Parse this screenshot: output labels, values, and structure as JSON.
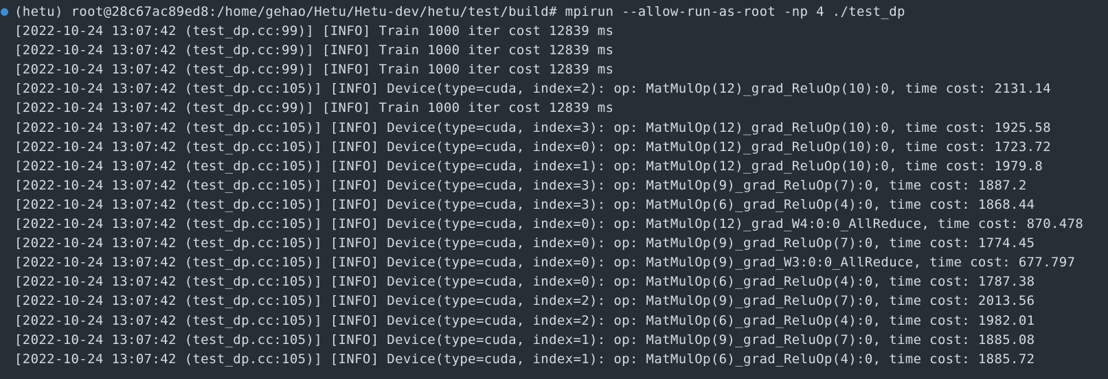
{
  "terminal": {
    "prompt": "(hetu) root@28c67ac89ed8:/home/gehao/Hetu/Hetu-dev/hetu/test/build# mpirun --allow-run-as-root -np 4 ./test_dp",
    "colors": {
      "background": "#262f36",
      "text": "#d6dbe0",
      "status_dot": "#3a8fd6"
    },
    "lines": [
      "[2022-10-24 13:07:42 (test_dp.cc:99)] [INFO] Train 1000 iter cost 12839 ms",
      "[2022-10-24 13:07:42 (test_dp.cc:99)] [INFO] Train 1000 iter cost 12839 ms",
      "[2022-10-24 13:07:42 (test_dp.cc:99)] [INFO] Train 1000 iter cost 12839 ms",
      "[2022-10-24 13:07:42 (test_dp.cc:105)] [INFO] Device(type=cuda, index=2): op: MatMulOp(12)_grad_ReluOp(10):0, time cost: 2131.14",
      "[2022-10-24 13:07:42 (test_dp.cc:99)] [INFO] Train 1000 iter cost 12839 ms",
      "[2022-10-24 13:07:42 (test_dp.cc:105)] [INFO] Device(type=cuda, index=3): op: MatMulOp(12)_grad_ReluOp(10):0, time cost: 1925.58",
      "[2022-10-24 13:07:42 (test_dp.cc:105)] [INFO] Device(type=cuda, index=0): op: MatMulOp(12)_grad_ReluOp(10):0, time cost: 1723.72",
      "[2022-10-24 13:07:42 (test_dp.cc:105)] [INFO] Device(type=cuda, index=1): op: MatMulOp(12)_grad_ReluOp(10):0, time cost: 1979.8",
      "[2022-10-24 13:07:42 (test_dp.cc:105)] [INFO] Device(type=cuda, index=3): op: MatMulOp(9)_grad_ReluOp(7):0, time cost: 1887.2",
      "[2022-10-24 13:07:42 (test_dp.cc:105)] [INFO] Device(type=cuda, index=3): op: MatMulOp(6)_grad_ReluOp(4):0, time cost: 1868.44",
      "[2022-10-24 13:07:42 (test_dp.cc:105)] [INFO] Device(type=cuda, index=0): op: MatMulOp(12)_grad_W4:0:0_AllReduce, time cost: 870.478",
      "[2022-10-24 13:07:42 (test_dp.cc:105)] [INFO] Device(type=cuda, index=0): op: MatMulOp(9)_grad_ReluOp(7):0, time cost: 1774.45",
      "[2022-10-24 13:07:42 (test_dp.cc:105)] [INFO] Device(type=cuda, index=0): op: MatMulOp(9)_grad_W3:0:0_AllReduce, time cost: 677.797",
      "[2022-10-24 13:07:42 (test_dp.cc:105)] [INFO] Device(type=cuda, index=0): op: MatMulOp(6)_grad_ReluOp(4):0, time cost: 1787.38",
      "[2022-10-24 13:07:42 (test_dp.cc:105)] [INFO] Device(type=cuda, index=2): op: MatMulOp(9)_grad_ReluOp(7):0, time cost: 2013.56",
      "[2022-10-24 13:07:42 (test_dp.cc:105)] [INFO] Device(type=cuda, index=2): op: MatMulOp(6)_grad_ReluOp(4):0, time cost: 1982.01",
      "[2022-10-24 13:07:42 (test_dp.cc:105)] [INFO] Device(type=cuda, index=1): op: MatMulOp(9)_grad_ReluOp(7):0, time cost: 1885.08",
      "[2022-10-24 13:07:42 (test_dp.cc:105)] [INFO] Device(type=cuda, index=1): op: MatMulOp(6)_grad_ReluOp(4):0, time cost: 1885.72"
    ]
  }
}
